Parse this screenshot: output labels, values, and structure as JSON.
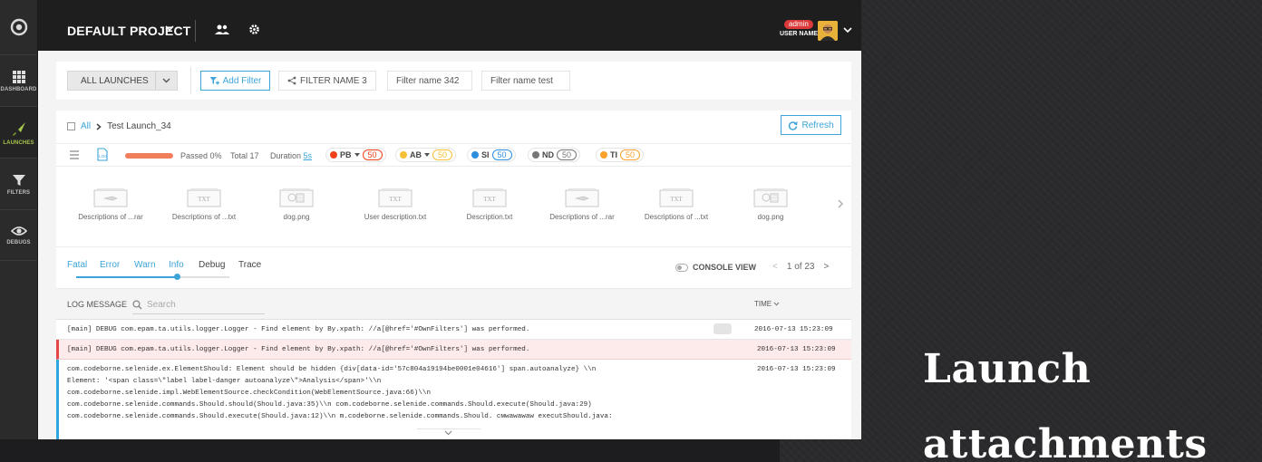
{
  "sidenav": {
    "items": [
      {
        "label": "DASHBOARD",
        "icon": "grid-icon"
      },
      {
        "label": "LAUNCHES",
        "icon": "rocket-icon"
      },
      {
        "label": "FILTERS",
        "icon": "funnel-icon"
      },
      {
        "label": "DEBUGS",
        "icon": "eye-icon"
      }
    ]
  },
  "header": {
    "project": "DEFAULT PROJECT",
    "role_badge": "admin",
    "user_name": "USER NAME"
  },
  "filterbar": {
    "launches_label": "ALL LAUNCHES",
    "add_filter_label": "Add Filter",
    "tabs": [
      "FILTER NAME 3",
      "Filter name 342",
      "Filter name test"
    ]
  },
  "breadcrumb": {
    "root": "All",
    "current": "Test Launch_34"
  },
  "refresh_label": "Refresh",
  "stats": {
    "passed_label": "Passed 0%",
    "total_label": "Total 17",
    "duration_label": "Duration",
    "duration_value": "5s",
    "passed_percent": 0,
    "defects": [
      {
        "code": "PB",
        "count": "50",
        "color": "#f0411a",
        "has_dropdown": true
      },
      {
        "code": "AB",
        "count": "50",
        "color": "#f7c137",
        "has_dropdown": true
      },
      {
        "code": "SI",
        "count": "50",
        "color": "#2e8ede",
        "has_dropdown": false
      },
      {
        "code": "ND",
        "count": "50",
        "color": "#777777",
        "has_dropdown": false
      },
      {
        "code": "TI",
        "count": "50",
        "color": "#fca12c",
        "has_dropdown": false
      }
    ]
  },
  "attachments": [
    {
      "name": "Descriptions of ...rar",
      "kind": "rar"
    },
    {
      "name": "Descriptions of ...txt",
      "kind": "txt"
    },
    {
      "name": "dog.png",
      "kind": "png"
    },
    {
      "name": "User description.txt",
      "kind": "txt"
    },
    {
      "name": "Description.txt",
      "kind": "txt"
    },
    {
      "name": "Descriptions of ...rar",
      "kind": "rar"
    },
    {
      "name": "Descriptions of ...txt",
      "kind": "txt"
    },
    {
      "name": "dog.png",
      "kind": "png"
    }
  ],
  "file_labels": {
    "txt": "TXT"
  },
  "log_levels": {
    "items": [
      "Fatal",
      "Error",
      "Warn",
      "Info",
      "Debug",
      "Trace"
    ],
    "selected": "Info"
  },
  "console_view_label": "CONSOLE VIEW",
  "pager": {
    "current": "1",
    "of_label": "of",
    "total": "23"
  },
  "log_table": {
    "message_header": "LOG MESSAGE",
    "search_placeholder": "Search",
    "time_header": "TIME"
  },
  "logs": [
    {
      "message": "[main] DEBUG com.epam.ta.utils.logger.Logger - Find element by By.xpath: //a[@href='#OwnFilters'] was performed.",
      "time": "2016-07-13  15:23:09",
      "level": "debug",
      "has_attachment": true
    },
    {
      "message": "[main] DEBUG com.epam.ta.utils.logger.Logger - Find element by By.xpath: //a[@href='#OwnFilters'] was performed.",
      "time": "2016-07-13  15:23:09",
      "level": "error",
      "has_attachment": false
    },
    {
      "lines": [
        "com.codeborne.selenide.ex.ElementShould: Element should be hidden {div[data-id='57c804a19194be0001e04616'] span.autoanalyze} \\\\n",
        "Element: '<span class=\\\"label label-danger autoanalyze\\\">Analysis</span>'\\\\n",
        "com.codeborne.selenide.impl.WebElementSource.checkCondition(WebElementSource.java:66)\\\\n",
        "com.codeborne.selenide.commands.Should.should(Should.java:35)\\\\n com.codeborne.selenide.commands.Should.execute(Should.java:29)",
        "com.codeborne.selenide.commands.Should.execute(Should.java:12)\\\\n m.codeborne.selenide.commands.Should. смwаwаwаw executShould.java:"
      ],
      "time": "2016-07-13  15:23:09",
      "level": "info"
    }
  ],
  "caption": {
    "line1": "Launch",
    "line2": "attachments"
  }
}
